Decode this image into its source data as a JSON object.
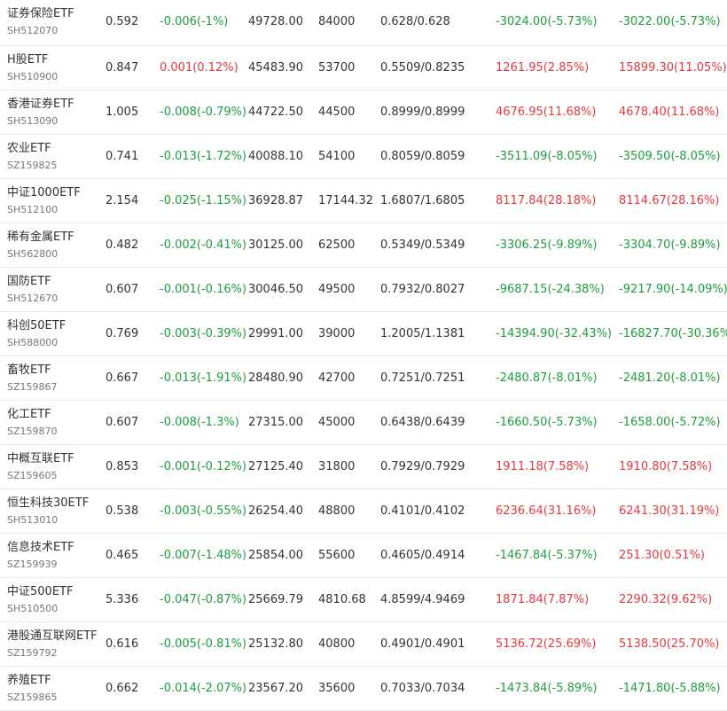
{
  "colors": {
    "up": "#e8383d",
    "down": "#1e9e3e",
    "text": "#333333",
    "code": "#777777",
    "divider": "#e8e8e8"
  },
  "rows": [
    {
      "name": "证券保险ETF",
      "code": "SH512070",
      "price": "0.592",
      "change": "-0.006(-1%)",
      "change_dir": "down",
      "amount": "49728.00",
      "volume": "84000",
      "bid_ask": "0.628/0.628",
      "flow1": "-3024.00(-5.73%)",
      "flow1_dir": "down",
      "flow2": "-3022.00(-5.73%)",
      "flow2_dir": "down"
    },
    {
      "name": "H股ETF",
      "code": "SH510900",
      "price": "0.847",
      "change": "0.001(0.12%)",
      "change_dir": "up",
      "amount": "45483.90",
      "volume": "53700",
      "bid_ask": "0.5509/0.8235",
      "flow1": "1261.95(2.85%)",
      "flow1_dir": "up",
      "flow2": "15899.30(11.05%)",
      "flow2_dir": "up"
    },
    {
      "name": "香港证券ETF",
      "code": "SH513090",
      "price": "1.005",
      "change": "-0.008(-0.79%)",
      "change_dir": "down",
      "amount": "44722.50",
      "volume": "44500",
      "bid_ask": "0.8999/0.8999",
      "flow1": "4676.95(11.68%)",
      "flow1_dir": "up",
      "flow2": "4678.40(11.68%)",
      "flow2_dir": "up"
    },
    {
      "name": "农业ETF",
      "code": "SZ159825",
      "price": "0.741",
      "change": "-0.013(-1.72%)",
      "change_dir": "down",
      "amount": "40088.10",
      "volume": "54100",
      "bid_ask": "0.8059/0.8059",
      "flow1": "-3511.09(-8.05%)",
      "flow1_dir": "down",
      "flow2": "-3509.50(-8.05%)",
      "flow2_dir": "down"
    },
    {
      "name": "中证1000ETF",
      "code": "SH512100",
      "price": "2.154",
      "change": "-0.025(-1.15%)",
      "change_dir": "down",
      "amount": "36928.87",
      "volume": "17144.32",
      "bid_ask": "1.6807/1.6805",
      "flow1": "8117.84(28.18%)",
      "flow1_dir": "up",
      "flow2": "8114.67(28.16%)",
      "flow2_dir": "up"
    },
    {
      "name": "稀有金属ETF",
      "code": "SH562800",
      "price": "0.482",
      "change": "-0.002(-0.41%)",
      "change_dir": "down",
      "amount": "30125.00",
      "volume": "62500",
      "bid_ask": "0.5349/0.5349",
      "flow1": "-3306.25(-9.89%)",
      "flow1_dir": "down",
      "flow2": "-3304.70(-9.89%)",
      "flow2_dir": "down"
    },
    {
      "name": "国防ETF",
      "code": "SH512670",
      "price": "0.607",
      "change": "-0.001(-0.16%)",
      "change_dir": "down",
      "amount": "30046.50",
      "volume": "49500",
      "bid_ask": "0.7932/0.8027",
      "flow1": "-9687.15(-24.38%)",
      "flow1_dir": "down",
      "flow2": "-9217.90(-14.09%)",
      "flow2_dir": "down"
    },
    {
      "name": "科创50ETF",
      "code": "SH588000",
      "price": "0.769",
      "change": "-0.003(-0.39%)",
      "change_dir": "down",
      "amount": "29991.00",
      "volume": "39000",
      "bid_ask": "1.2005/1.1381",
      "flow1": "-14394.90(-32.43%)",
      "flow1_dir": "down",
      "flow2": "-16827.70(-30.36%)",
      "flow2_dir": "down"
    },
    {
      "name": "畜牧ETF",
      "code": "SZ159867",
      "price": "0.667",
      "change": "-0.013(-1.91%)",
      "change_dir": "down",
      "amount": "28480.90",
      "volume": "42700",
      "bid_ask": "0.7251/0.7251",
      "flow1": "-2480.87(-8.01%)",
      "flow1_dir": "down",
      "flow2": "-2481.20(-8.01%)",
      "flow2_dir": "down"
    },
    {
      "name": "化工ETF",
      "code": "SZ159870",
      "price": "0.607",
      "change": "-0.008(-1.3%)",
      "change_dir": "down",
      "amount": "27315.00",
      "volume": "45000",
      "bid_ask": "0.6438/0.6439",
      "flow1": "-1660.50(-5.73%)",
      "flow1_dir": "down",
      "flow2": "-1658.00(-5.72%)",
      "flow2_dir": "down"
    },
    {
      "name": "中概互联ETF",
      "code": "SZ159605",
      "price": "0.853",
      "change": "-0.001(-0.12%)",
      "change_dir": "down",
      "amount": "27125.40",
      "volume": "31800",
      "bid_ask": "0.7929/0.7929",
      "flow1": "1911.18(7.58%)",
      "flow1_dir": "up",
      "flow2": "1910.80(7.58%)",
      "flow2_dir": "up"
    },
    {
      "name": "恒生科技30ETF",
      "code": "SH513010",
      "price": "0.538",
      "change": "-0.003(-0.55%)",
      "change_dir": "down",
      "amount": "26254.40",
      "volume": "48800",
      "bid_ask": "0.4101/0.4102",
      "flow1": "6236.64(31.16%)",
      "flow1_dir": "up",
      "flow2": "6241.30(31.19%)",
      "flow2_dir": "up"
    },
    {
      "name": "信息技术ETF",
      "code": "SZ159939",
      "price": "0.465",
      "change": "-0.007(-1.48%)",
      "change_dir": "down",
      "amount": "25854.00",
      "volume": "55600",
      "bid_ask": "0.4605/0.4914",
      "flow1": "-1467.84(-5.37%)",
      "flow1_dir": "down",
      "flow2": "251.30(0.51%)",
      "flow2_dir": "up"
    },
    {
      "name": "中证500ETF",
      "code": "SH510500",
      "price": "5.336",
      "change": "-0.047(-0.87%)",
      "change_dir": "down",
      "amount": "25669.79",
      "volume": "4810.68",
      "bid_ask": "4.8599/4.9469",
      "flow1": "1871.84(7.87%)",
      "flow1_dir": "up",
      "flow2": "2290.32(9.62%)",
      "flow2_dir": "up"
    },
    {
      "name": "港股通互联网ETF",
      "code": "SZ159792",
      "price": "0.616",
      "change": "-0.005(-0.81%)",
      "change_dir": "down",
      "amount": "25132.80",
      "volume": "40800",
      "bid_ask": "0.4901/0.4901",
      "flow1": "5136.72(25.69%)",
      "flow1_dir": "up",
      "flow2": "5138.50(25.70%)",
      "flow2_dir": "up"
    },
    {
      "name": "养殖ETF",
      "code": "SZ159865",
      "price": "0.662",
      "change": "-0.014(-2.07%)",
      "change_dir": "down",
      "amount": "23567.20",
      "volume": "35600",
      "bid_ask": "0.7033/0.7034",
      "flow1": "-1473.84(-5.89%)",
      "flow1_dir": "down",
      "flow2": "-1471.80(-5.88%)",
      "flow2_dir": "down"
    }
  ]
}
